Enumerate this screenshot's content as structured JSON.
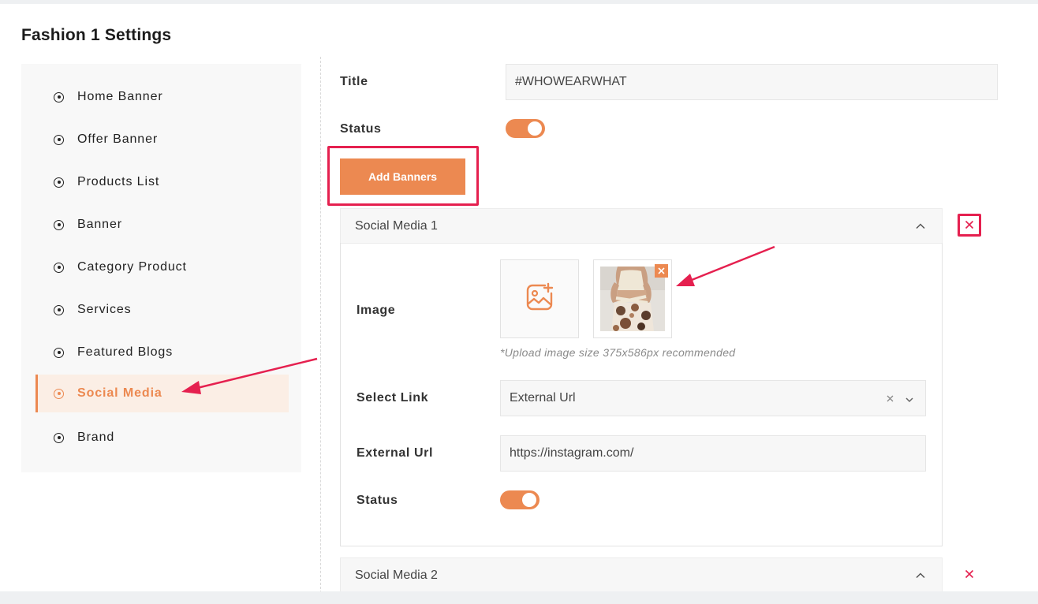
{
  "page": {
    "title": "Fashion 1 Settings"
  },
  "sidebar": {
    "items": [
      {
        "label": "Home Banner",
        "active": false
      },
      {
        "label": "Offer Banner",
        "active": false
      },
      {
        "label": "Products List",
        "active": false
      },
      {
        "label": "Banner",
        "active": false
      },
      {
        "label": "Category Product",
        "active": false
      },
      {
        "label": "Services",
        "active": false
      },
      {
        "label": "Featured Blogs",
        "active": false
      },
      {
        "label": "Social Media",
        "active": true
      },
      {
        "label": "Brand",
        "active": false
      }
    ]
  },
  "form": {
    "title_label": "Title",
    "title_value": "#WHOWEARWHAT",
    "status_label": "Status",
    "status_on": true,
    "add_button": "Add Banners"
  },
  "banners": [
    {
      "header": "Social Media 1",
      "expanded": true,
      "image_label": "Image",
      "image_hint": "*Upload image size 375x586px recommended",
      "select_link_label": "Select Link",
      "select_link_value": "External Url",
      "external_url_label": "External Url",
      "external_url_value": "https://instagram.com/",
      "status_label": "Status",
      "status_on": true
    },
    {
      "header": "Social Media 2",
      "expanded": true
    }
  ],
  "colors": {
    "accent": "#ec8951",
    "annotation": "#e5204f",
    "active_bg": "#fbeee5"
  },
  "icons": {
    "sidebar_bullet": "radio-dot-icon",
    "upload": "image-add-icon",
    "collapse": "chevron-up-icon",
    "remove": "close-icon",
    "select_caret": "chevron-down-icon",
    "select_clear": "clear-icon"
  }
}
